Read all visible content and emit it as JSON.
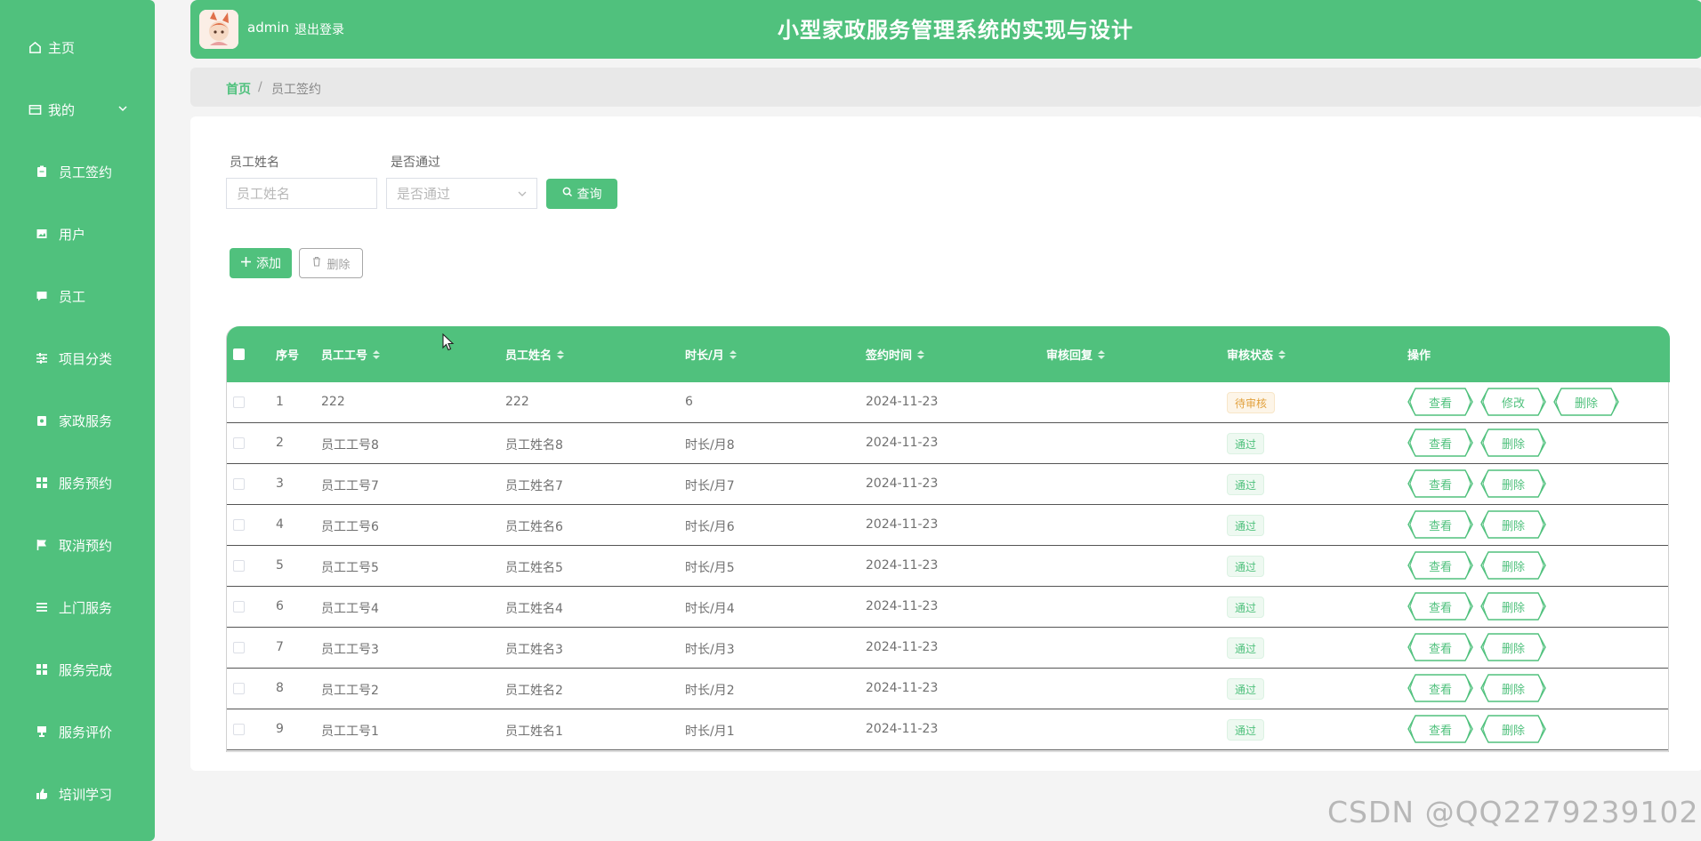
{
  "sidebar": {
    "home": "主页",
    "mine": "我的",
    "items": [
      {
        "label": "员工签约",
        "icon": "clipboard-icon"
      },
      {
        "label": "用户",
        "icon": "picture-icon"
      },
      {
        "label": "员工",
        "icon": "chat-icon"
      },
      {
        "label": "项目分类",
        "icon": "sliders-icon"
      },
      {
        "label": "家政服务",
        "icon": "lock-box-icon"
      },
      {
        "label": "服务预约",
        "icon": "grid-icon"
      },
      {
        "label": "取消预约",
        "icon": "flag-icon"
      },
      {
        "label": "上门服务",
        "icon": "list-icon"
      },
      {
        "label": "服务完成",
        "icon": "grid-icon"
      },
      {
        "label": "服务评价",
        "icon": "cup-icon"
      },
      {
        "label": "培训学习",
        "icon": "thumb-icon"
      }
    ]
  },
  "header": {
    "username": "admin",
    "logout": "退出登录",
    "title": "小型家政服务管理系统的实现与设计"
  },
  "breadcrumb": {
    "home": "首页",
    "separator": "/",
    "current": "员工签约"
  },
  "filters": {
    "name_label": "员工姓名",
    "name_placeholder": "员工姓名",
    "pass_label": "是否通过",
    "pass_placeholder": "是否通过",
    "search_button": "查询"
  },
  "actions": {
    "add": "添加",
    "delete": "删除"
  },
  "table": {
    "columns": [
      "序号",
      "员工工号",
      "员工姓名",
      "时长/月",
      "签约时间",
      "审核回复",
      "审核状态",
      "操作"
    ],
    "rows": [
      {
        "no": "1",
        "emp_id": "222",
        "emp_name": "222",
        "duration": "6",
        "date": "2024-11-23",
        "reply": "",
        "status": "待审核",
        "ops": [
          "查看",
          "修改",
          "删除"
        ]
      },
      {
        "no": "2",
        "emp_id": "员工工号8",
        "emp_name": "员工姓名8",
        "duration": "时长/月8",
        "date": "2024-11-23",
        "reply": "",
        "status": "通过",
        "ops": [
          "查看",
          "删除"
        ]
      },
      {
        "no": "3",
        "emp_id": "员工工号7",
        "emp_name": "员工姓名7",
        "duration": "时长/月7",
        "date": "2024-11-23",
        "reply": "",
        "status": "通过",
        "ops": [
          "查看",
          "删除"
        ]
      },
      {
        "no": "4",
        "emp_id": "员工工号6",
        "emp_name": "员工姓名6",
        "duration": "时长/月6",
        "date": "2024-11-23",
        "reply": "",
        "status": "通过",
        "ops": [
          "查看",
          "删除"
        ]
      },
      {
        "no": "5",
        "emp_id": "员工工号5",
        "emp_name": "员工姓名5",
        "duration": "时长/月5",
        "date": "2024-11-23",
        "reply": "",
        "status": "通过",
        "ops": [
          "查看",
          "删除"
        ]
      },
      {
        "no": "6",
        "emp_id": "员工工号4",
        "emp_name": "员工姓名4",
        "duration": "时长/月4",
        "date": "2024-11-23",
        "reply": "",
        "status": "通过",
        "ops": [
          "查看",
          "删除"
        ]
      },
      {
        "no": "7",
        "emp_id": "员工工号3",
        "emp_name": "员工姓名3",
        "duration": "时长/月3",
        "date": "2024-11-23",
        "reply": "",
        "status": "通过",
        "ops": [
          "查看",
          "删除"
        ]
      },
      {
        "no": "8",
        "emp_id": "员工工号2",
        "emp_name": "员工姓名2",
        "duration": "时长/月2",
        "date": "2024-11-23",
        "reply": "",
        "status": "通过",
        "ops": [
          "查看",
          "删除"
        ]
      },
      {
        "no": "9",
        "emp_id": "员工工号1",
        "emp_name": "员工姓名1",
        "duration": "时长/月1",
        "date": "2024-11-23",
        "reply": "",
        "status": "通过",
        "ops": [
          "查看",
          "删除"
        ]
      }
    ]
  },
  "watermark": "CSDN @QQ2279239102",
  "colors": {
    "primary": "#50c17d",
    "pass_text": "#50c17d",
    "wait_text": "#e2a23f",
    "page_bg": "#f4f4f4"
  }
}
